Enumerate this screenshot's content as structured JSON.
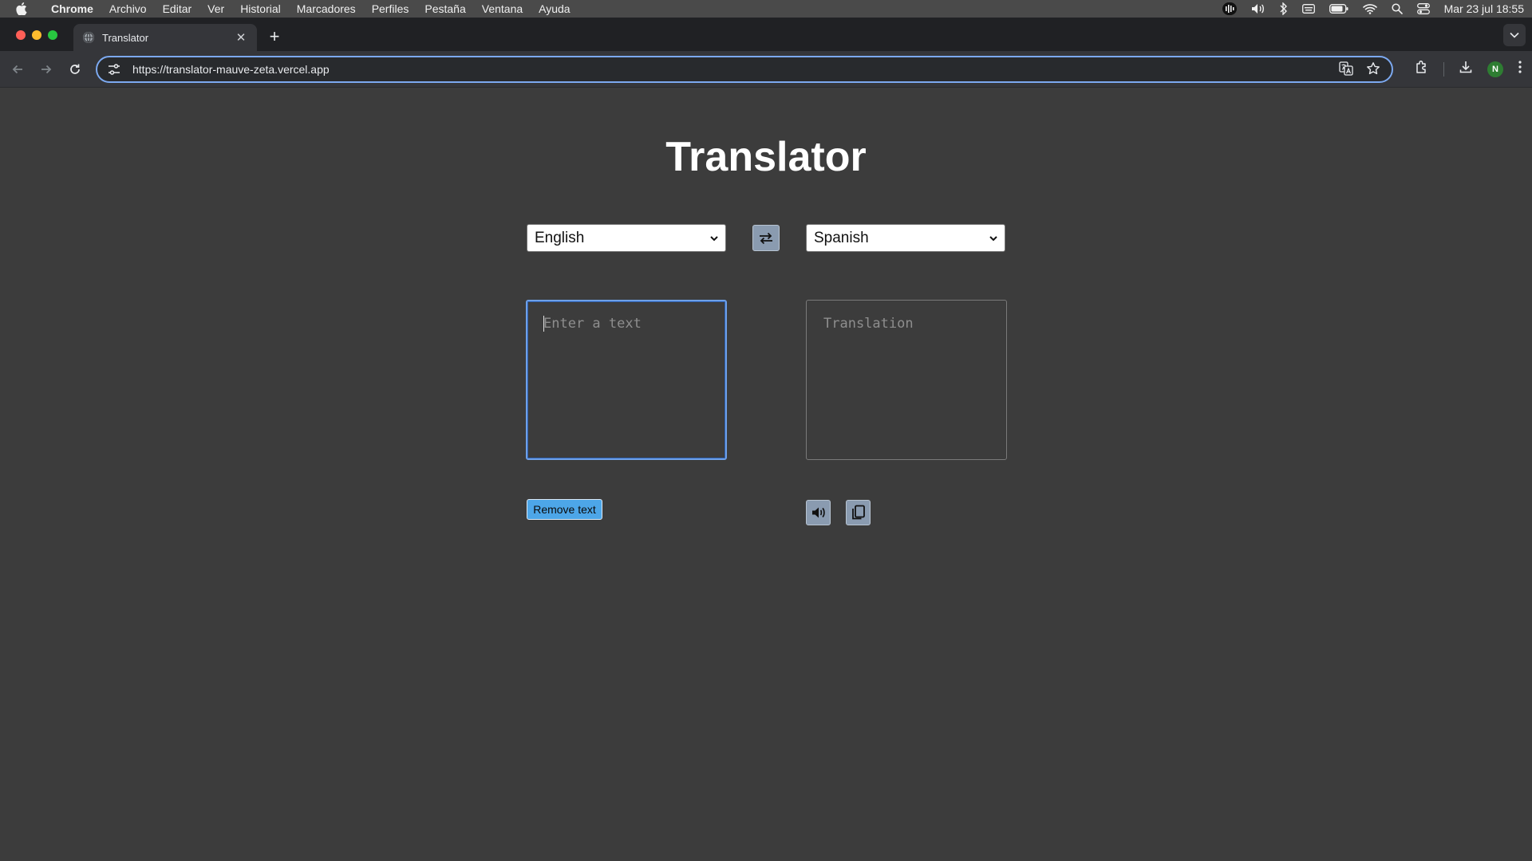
{
  "menubar": {
    "app": "Chrome",
    "items": [
      "Archivo",
      "Editar",
      "Ver",
      "Historial",
      "Marcadores",
      "Perfiles",
      "Pestaña",
      "Ventana",
      "Ayuda"
    ],
    "datetime": "Mar 23 jul  18:55"
  },
  "tab": {
    "title": "Translator"
  },
  "omnibox": {
    "url": "https://translator-mauve-zeta.vercel.app"
  },
  "profile": {
    "initial": "N"
  },
  "page": {
    "title": "Translator",
    "source_language": "English",
    "target_language": "Spanish",
    "input_placeholder": "Enter a text",
    "output_placeholder": "Translation",
    "remove_button": "Remove text"
  },
  "colors": {
    "background": "#3c3c3c",
    "accent_button": "#4da6e8",
    "icon_button": "#8a9bb0",
    "focus_border": "#6ea0e8"
  },
  "icons": [
    "apple-icon",
    "siri-icon",
    "volume-icon",
    "bluetooth-icon",
    "keyboard-icon",
    "battery-icon",
    "wifi-icon",
    "spotlight-icon",
    "control-center-icon",
    "back-icon",
    "forward-icon",
    "reload-icon",
    "translate-icon",
    "star-icon",
    "extensions-icon",
    "download-icon",
    "kebab-menu-icon",
    "swap-icon",
    "speaker-icon",
    "copy-icon"
  ]
}
